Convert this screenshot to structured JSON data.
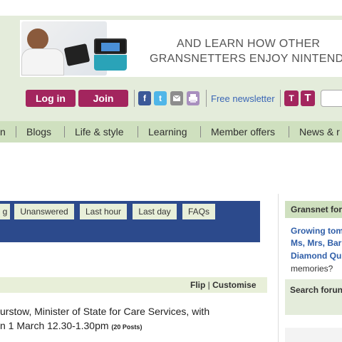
{
  "banner": {
    "line1": "AND LEARN HOW OTHER",
    "line2": "GRANSNETTERS ENJOY NINTENDO"
  },
  "header": {
    "login_label": "Log in",
    "join_label": "Join",
    "social": {
      "facebook": "f",
      "twitter": "t"
    },
    "newsletter_label": "Free newsletter",
    "text_small_label": "T",
    "text_large_label": "T"
  },
  "nav": {
    "items": [
      "n",
      "Blogs",
      "Life & style",
      "Learning",
      "Member offers",
      "News & r"
    ]
  },
  "forum": {
    "tabs": [
      "g",
      "Unanswered",
      "Last hour",
      "Last day",
      "FAQs"
    ],
    "flip_label": "Flip",
    "separator": "|",
    "customise_label": "Customise",
    "thread_line1": "urstow, Minister of State for Care Services, with",
    "thread_line2": "n 1 March 12.30-1.30pm",
    "post_count": "(20 Posts)"
  },
  "sidebar": {
    "panel_title": "Gransnet for",
    "links": [
      "Growing tom",
      "Ms, Mrs, Bar",
      "Diamond Qu"
    ],
    "memories_text": "memories?",
    "search_title": "Search forun"
  },
  "colors": {
    "brand_purple": "#a3255e",
    "nav_green": "#cfe0bf",
    "tab_blue": "#2c4a8c",
    "link_blue": "#2f5ea8"
  }
}
